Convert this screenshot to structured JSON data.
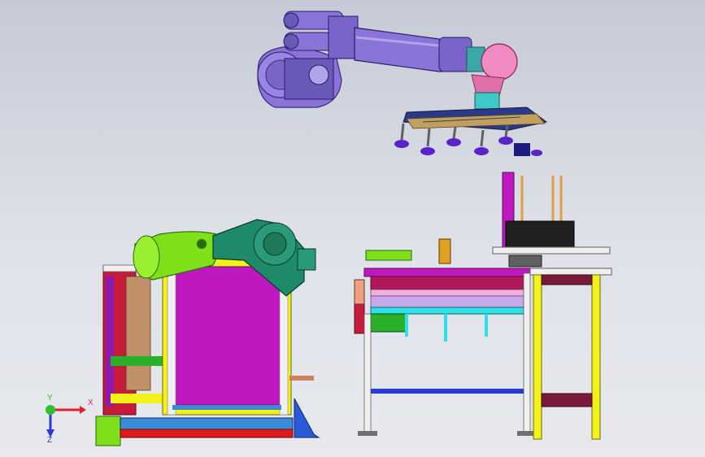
{
  "viewport": {
    "background_top": "#c5cad6",
    "background_bottom": "#e7e9ee"
  },
  "triad": {
    "x_label": "X",
    "y_label": "Y",
    "z_label": "Z",
    "x_color": "#e0202a",
    "y_color": "#2ec02e",
    "z_color": "#2a3ad8"
  },
  "colors": {
    "robot_body": "#8a74d8",
    "robot_dark": "#5a4aa8",
    "robot_wrist": "#f08ac0",
    "suction_cup": "#5a22c8",
    "motor_green": "#7fe01a",
    "gearbox_teal": "#1f8a6a",
    "frame_yellow": "#f2f21a",
    "panel_magenta": "#c018c0",
    "frame_red": "#c81a3a",
    "base_blue": "#2a5ad8",
    "rail_cyan": "#30e0e8",
    "frame_white": "#f0f0f0"
  },
  "scene": {
    "components": [
      "robot-arm",
      "end-effector-gripper",
      "unloading-station",
      "conveyor-table",
      "stacking-rack"
    ]
  }
}
